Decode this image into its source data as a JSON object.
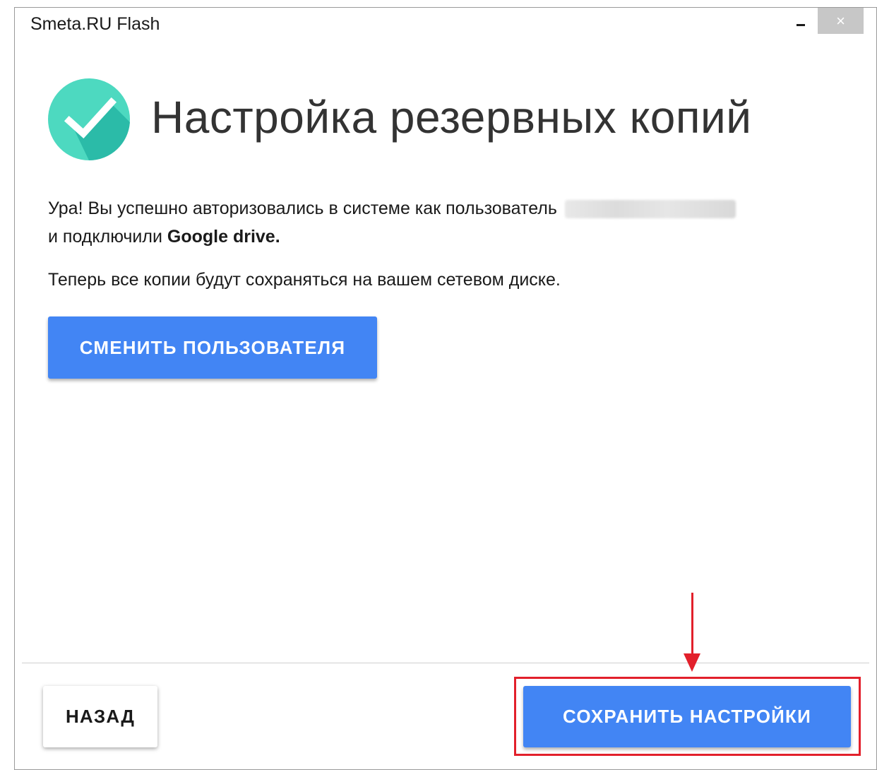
{
  "window": {
    "title": "Smeta.RU Flash",
    "minimize_icon": "minimize-icon",
    "close_icon": "close-icon",
    "close_glyph": "×"
  },
  "header": {
    "logo_icon": "checkmark-circle-icon",
    "title": "Настройка резервных копий",
    "colors": {
      "logo_light": "#4dd9c0",
      "logo_dark": "#26b5a3"
    }
  },
  "message": {
    "line1": "Ура! Вы успешно авторизовались в системе как пользователь",
    "line2_prefix": "и подключили ",
    "service": "Google drive.",
    "info": "Теперь все копии будут сохраняться на вашем сетевом диске."
  },
  "buttons": {
    "change_user": "СМЕНИТЬ ПОЛЬЗОВАТЕЛЯ",
    "back": "НАЗАД",
    "save": "СОХРАНИТЬ НАСТРОЙКИ"
  },
  "colors": {
    "primary": "#4285f4",
    "annotation": "#e2202b"
  }
}
